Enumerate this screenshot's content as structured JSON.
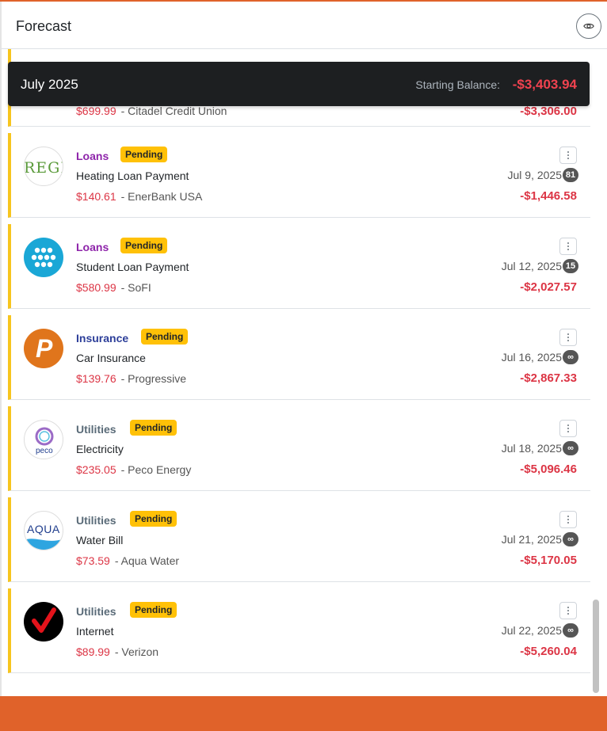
{
  "header": {
    "title": "Forecast",
    "eye_icon": "eye-icon"
  },
  "month_bar": {
    "month": "July 2025",
    "starting_balance_label": "Starting Balance:",
    "starting_balance": "-$3,403.94"
  },
  "partial_row": {
    "amount": "$699.99",
    "payee": "- Citadel Credit Union",
    "balance": "-$3,306.00"
  },
  "colors": {
    "accent": "#e0622a",
    "pending": "#ffc107",
    "negative": "#dc3545",
    "loans": "#8e24aa",
    "insurance": "#2c3e99",
    "utilities": "#5a6b78"
  },
  "rows": [
    {
      "category": "Loans",
      "status": "Pending",
      "name": "Heating Loan Payment",
      "amount": "$140.61",
      "payee": "- EnerBank USA",
      "date": "Jul 9, 2025",
      "count": "81",
      "balance": "-$1,446.58",
      "logo": "regions-logo",
      "logo_text": "REGI"
    },
    {
      "category": "Loans",
      "status": "Pending",
      "name": "Student Loan Payment",
      "amount": "$580.99",
      "payee": "- SoFI",
      "date": "Jul 12, 2025",
      "count": "15",
      "balance": "-$2,027.57",
      "logo": "sofi-logo"
    },
    {
      "category": "Insurance",
      "status": "Pending",
      "name": "Car Insurance",
      "amount": "$139.76",
      "payee": "- Progressive",
      "date": "Jul 16, 2025",
      "count": "∞",
      "balance": "-$2,867.33",
      "logo": "progressive-logo",
      "logo_text": "P"
    },
    {
      "category": "Utilities",
      "status": "Pending",
      "name": "Electricity",
      "amount": "$235.05",
      "payee": "- Peco Energy",
      "date": "Jul 18, 2025",
      "count": "∞",
      "balance": "-$5,096.46",
      "logo": "peco-logo",
      "logo_text": "peco"
    },
    {
      "category": "Utilities",
      "status": "Pending",
      "name": "Water Bill",
      "amount": "$73.59",
      "payee": "- Aqua Water",
      "date": "Jul 21, 2025",
      "count": "∞",
      "balance": "-$5,170.05",
      "logo": "aqua-logo",
      "logo_text": "AQUA"
    },
    {
      "category": "Utilities",
      "status": "Pending",
      "name": "Internet",
      "amount": "$89.99",
      "payee": "- Verizon",
      "date": "Jul 22, 2025",
      "count": "∞",
      "balance": "-$5,260.04",
      "logo": "verizon-logo"
    }
  ]
}
